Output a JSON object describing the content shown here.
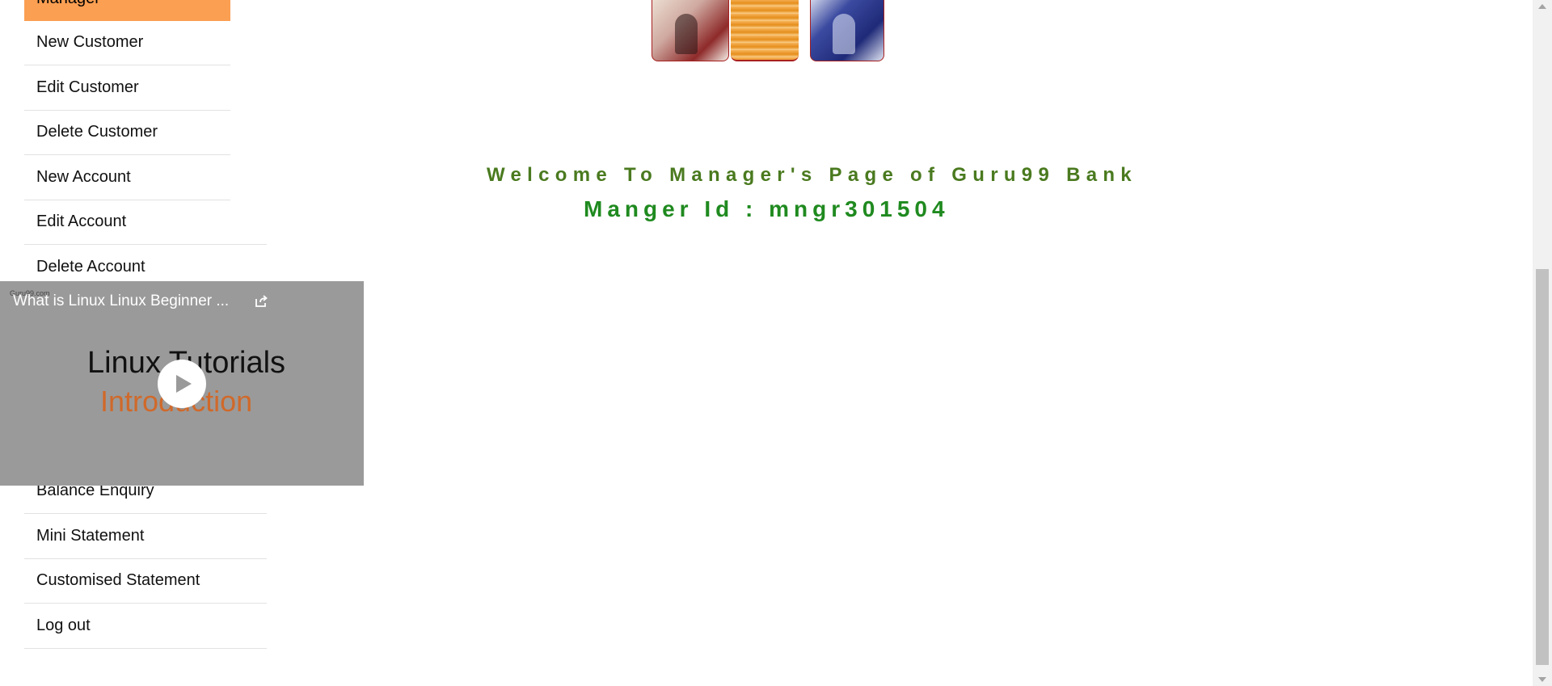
{
  "menu": {
    "header_label": "Manager",
    "items": [
      {
        "label": "New Customer"
      },
      {
        "label": "Edit Customer"
      },
      {
        "label": "Delete Customer"
      },
      {
        "label": "New Account"
      },
      {
        "label": "Edit Account"
      },
      {
        "label": "Delete Account"
      },
      {
        "label": "Balance Enquiry"
      },
      {
        "label": "Mini Statement"
      },
      {
        "label": "Customised Statement"
      },
      {
        "label": "Log out"
      }
    ]
  },
  "main": {
    "welcome_text": "Welcome To Manager's Page of Guru99 Bank",
    "manager_id_text": "Manger Id : mngr301504"
  },
  "video": {
    "title": "What is Linux Linux Beginner ...",
    "watermark": "Guru99.com",
    "slide_title": "Linux Tutorials",
    "slide_subtitle": "Introduction",
    "play_icon": "play-icon",
    "share_icon": "share-icon"
  },
  "colors": {
    "menu_header": "#fb9f52",
    "welcome": "#4a7a1f",
    "manager_id": "#1f8a1f",
    "video_bg": "#9a9a9a"
  }
}
